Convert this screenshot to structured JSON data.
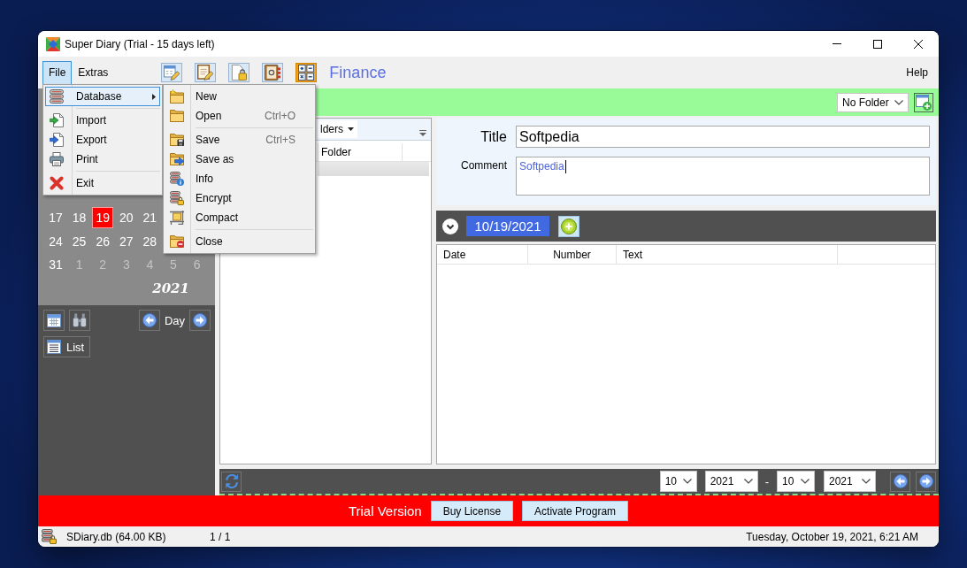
{
  "window": {
    "title": "Super Diary (Trial - 15 days left)"
  },
  "menu_bar": [
    {
      "label": "File",
      "open": true
    },
    {
      "label": "Extras",
      "open": false
    }
  ],
  "toolbar": [
    {
      "selected": false
    },
    {
      "selected": false
    },
    {
      "selected": false
    },
    {
      "selected": false
    },
    {
      "selected": true
    }
  ],
  "category": {
    "title": "Finance"
  },
  "help_menu": {
    "label": "Help"
  },
  "file_menu": [
    {
      "kind": "item",
      "label": "Database",
      "selected": true,
      "submenu": true
    },
    {
      "kind": "separator"
    },
    {
      "kind": "item",
      "label": "Import",
      "selected": false,
      "submenu": false
    },
    {
      "kind": "item",
      "label": "Export",
      "selected": false,
      "submenu": false
    },
    {
      "kind": "item",
      "label": "Print",
      "selected": false,
      "submenu": false
    },
    {
      "kind": "separator"
    },
    {
      "kind": "item",
      "label": "Exit",
      "selected": false,
      "submenu": false
    }
  ],
  "database_menu": [
    {
      "kind": "item",
      "label": "New"
    },
    {
      "kind": "item",
      "label": "Open",
      "shortcut": "Ctrl+O"
    },
    {
      "kind": "separator"
    },
    {
      "kind": "item",
      "label": "Save",
      "shortcut": "Ctrl+S"
    },
    {
      "kind": "item",
      "label": "Save as"
    },
    {
      "kind": "item",
      "label": "Info"
    },
    {
      "kind": "item",
      "label": "Encrypt"
    },
    {
      "kind": "item",
      "label": "Compact"
    },
    {
      "kind": "separator"
    },
    {
      "kind": "item",
      "label": "Close"
    }
  ],
  "folder_bar": {
    "folder": "No Folder"
  },
  "calendar": {
    "weeks": [
      [
        {
          "day": "17",
          "selected": false,
          "other_month": false
        },
        {
          "day": "18",
          "selected": false,
          "other_month": false
        },
        {
          "day": "19",
          "selected": true,
          "other_month": false
        },
        {
          "day": "20",
          "selected": false,
          "other_month": false
        },
        {
          "day": "21",
          "selected": false,
          "other_month": false
        }
      ],
      [
        {
          "day": "24",
          "selected": false,
          "other_month": false
        },
        {
          "day": "25",
          "selected": false,
          "other_month": false
        },
        {
          "day": "26",
          "selected": false,
          "other_month": false
        },
        {
          "day": "27",
          "selected": false,
          "other_month": false
        },
        {
          "day": "28",
          "selected": false,
          "other_month": false
        }
      ],
      [
        {
          "day": "31",
          "selected": false,
          "other_month": false
        },
        {
          "day": "1",
          "selected": false,
          "other_month": true
        },
        {
          "day": "2",
          "selected": false,
          "other_month": true
        },
        {
          "day": "3",
          "selected": false,
          "other_month": true
        },
        {
          "day": "4",
          "selected": false,
          "other_month": true
        },
        {
          "day": "5",
          "selected": false,
          "other_month": true
        },
        {
          "day": "6",
          "selected": false,
          "other_month": true
        }
      ]
    ],
    "year": "2021"
  },
  "calendar_nav": {
    "period": "Day",
    "list_button": "List"
  },
  "folders_panel": {
    "dropdown": "lders",
    "columns": [
      "Folder"
    ]
  },
  "entry": {
    "title_label": "Title",
    "title": "Softpedia",
    "comment_label": "Comment",
    "comment": "Softpedia",
    "comment_focused": true
  },
  "day_bar": {
    "date": "10/19/2021"
  },
  "entries_table": {
    "columns": [
      "Date",
      "Number",
      "Text"
    ]
  },
  "range": {
    "from_month": "10",
    "from_year": "2021",
    "separator": "-",
    "to_month": "10",
    "to_year": "2021"
  },
  "trial_bar": {
    "label": "Trial Version",
    "buttons": [
      "Buy License",
      "Activate Program"
    ]
  },
  "status_bar": {
    "file": "SDiary.db (64.00 KB)",
    "record": "1 / 1",
    "datetime": "Tuesday, October 19, 2021, 6:21 AM"
  }
}
